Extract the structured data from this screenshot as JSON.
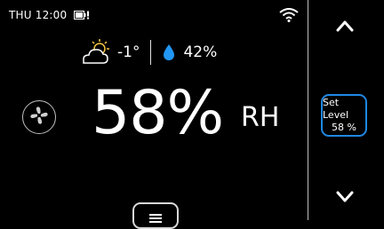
{
  "status_bar": {
    "time": "THU 12:00",
    "battery_icon": "battery-alert-icon",
    "wifi_icon": "wifi-icon"
  },
  "weather": {
    "icon": "partly-cloudy-icon",
    "temperature": "-1°",
    "humidity_icon": "water-drop-icon",
    "humidity": "42%"
  },
  "main": {
    "fan_icon": "fan-icon",
    "reading": "58%",
    "unit": "RH"
  },
  "side": {
    "up_icon": "chevron-up-icon",
    "set_level_label": "Set Level",
    "set_level_value": "58 %",
    "down_icon": "chevron-down-icon"
  },
  "bottom": {
    "menu_icon": "menu-icon"
  },
  "colors": {
    "background": "#000000",
    "accent": "#1e88e5",
    "drop": "#2196f3"
  }
}
